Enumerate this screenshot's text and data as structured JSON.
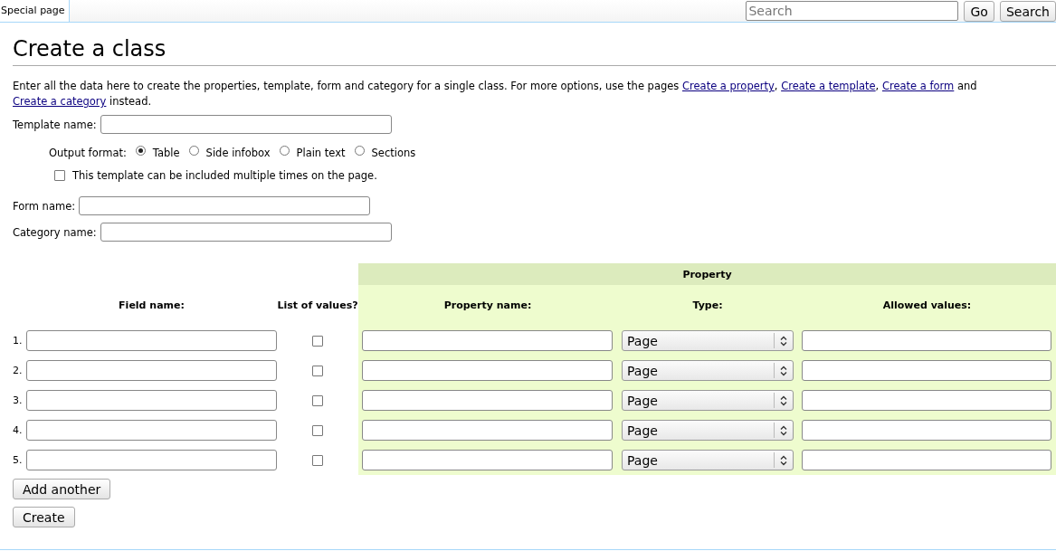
{
  "header": {
    "tab": {
      "label": "Special page",
      "selected": true
    },
    "search": {
      "placeholder": "Search"
    },
    "buttons": [
      "Go",
      "Search"
    ]
  },
  "title": "Create a class",
  "intro": [
    {
      "kind": "text",
      "text": "Enter all the data here to create the properties, template, form and category for a single class. For more options, use the pages "
    },
    {
      "kind": "link",
      "text": "Create a property"
    },
    {
      "kind": "text",
      "text": ", "
    },
    {
      "kind": "link",
      "text": "Create a template"
    },
    {
      "kind": "text",
      "text": ", "
    },
    {
      "kind": "link",
      "text": "Create a form"
    },
    {
      "kind": "text",
      "text": " and "
    },
    {
      "kind": "link",
      "text": "Create a category"
    },
    {
      "kind": "text",
      "text": " instead."
    }
  ],
  "template_name": {
    "label": "Template name:"
  },
  "output_format": {
    "label": "Output format:",
    "options": [
      {
        "label": "Table",
        "selected": true
      },
      {
        "label": "Side infobox",
        "selected": false
      },
      {
        "label": "Plain text",
        "selected": false
      },
      {
        "label": "Sections",
        "selected": false
      }
    ]
  },
  "multiple": {
    "label": "This template can be included multiple times on the page.",
    "checked": false
  },
  "form_name": {
    "label": "Form name:"
  },
  "category_name": {
    "label": "Category name:"
  },
  "table": {
    "group_header": "Property",
    "columns": [
      "Field name:",
      "List of values?",
      "Property name:",
      "Type:",
      "Allowed values:"
    ],
    "rows": [
      {
        "number": "1.",
        "list_of_values": false,
        "type": "Page"
      },
      {
        "number": "2.",
        "list_of_values": false,
        "type": "Page"
      },
      {
        "number": "3.",
        "list_of_values": false,
        "type": "Page"
      },
      {
        "number": "4.",
        "list_of_values": false,
        "type": "Page"
      },
      {
        "number": "5.",
        "list_of_values": false,
        "type": "Page"
      }
    ]
  },
  "buttons": [
    "Add another",
    "Create"
  ]
}
